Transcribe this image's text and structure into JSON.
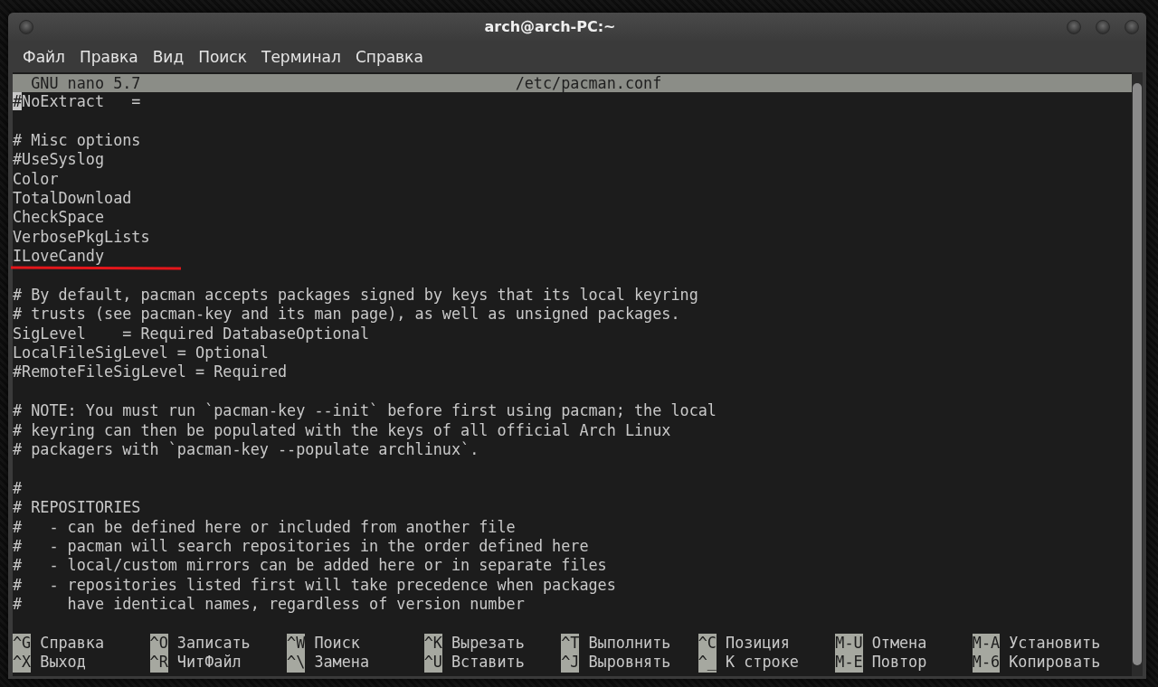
{
  "window": {
    "title": "arch@arch-PC:~"
  },
  "menu": [
    {
      "label": "Файл"
    },
    {
      "label": "Правка"
    },
    {
      "label": "Вид"
    },
    {
      "label": "Поиск"
    },
    {
      "label": "Терминал"
    },
    {
      "label": "Справка"
    }
  ],
  "nano_header": {
    "version": "GNU nano 5.7",
    "filename": "/etc/pacman.conf"
  },
  "lines": [
    {
      "kind": "text",
      "text": "#NoExtract   =",
      "cursor": true
    },
    {
      "kind": "blank"
    },
    {
      "kind": "text",
      "text": "# Misc options"
    },
    {
      "kind": "text",
      "text": "#UseSyslog"
    },
    {
      "kind": "text",
      "text": "Color"
    },
    {
      "kind": "text",
      "text": "TotalDownload"
    },
    {
      "kind": "text",
      "text": "CheckSpace"
    },
    {
      "kind": "text",
      "text": "VerbosePkgLists"
    },
    {
      "kind": "text",
      "text": "ILoveCandy",
      "underlined": true
    },
    {
      "kind": "blank"
    },
    {
      "kind": "text",
      "text": "# By default, pacman accepts packages signed by keys that its local keyring"
    },
    {
      "kind": "text",
      "text": "# trusts (see pacman-key and its man page), as well as unsigned packages."
    },
    {
      "kind": "text",
      "text": "SigLevel    = Required DatabaseOptional"
    },
    {
      "kind": "text",
      "text": "LocalFileSigLevel = Optional"
    },
    {
      "kind": "text",
      "text": "#RemoteFileSigLevel = Required"
    },
    {
      "kind": "blank"
    },
    {
      "kind": "text",
      "text": "# NOTE: You must run `pacman-key --init` before first using pacman; the local"
    },
    {
      "kind": "text",
      "text": "# keyring can then be populated with the keys of all official Arch Linux"
    },
    {
      "kind": "text",
      "text": "# packagers with `pacman-key --populate archlinux`."
    },
    {
      "kind": "blank"
    },
    {
      "kind": "text",
      "text": "#"
    },
    {
      "kind": "text",
      "text": "# REPOSITORIES"
    },
    {
      "kind": "text",
      "text": "#   - can be defined here or included from another file"
    },
    {
      "kind": "text",
      "text": "#   - pacman will search repositories in the order defined here"
    },
    {
      "kind": "text",
      "text": "#   - local/custom mirrors can be added here or in separate files"
    },
    {
      "kind": "text",
      "text": "#   - repositories listed first will take precedence when packages"
    },
    {
      "kind": "text",
      "text": "#     have identical names, regardless of version number"
    },
    {
      "kind": "blank"
    }
  ],
  "shortcuts": [
    [
      {
        "key": "^G",
        "label": "Справка"
      },
      {
        "key": "^O",
        "label": "Записать"
      },
      {
        "key": "^W",
        "label": "Поиск"
      },
      {
        "key": "^K",
        "label": "Вырезать"
      },
      {
        "key": "^T",
        "label": "Выполнить"
      },
      {
        "key": "^C",
        "label": "Позиция"
      },
      {
        "key": "M-U",
        "label": "Отмена"
      },
      {
        "key": "M-A",
        "label": "Установить"
      }
    ],
    [
      {
        "key": "^X",
        "label": "Выход"
      },
      {
        "key": "^R",
        "label": "ЧитФайл"
      },
      {
        "key": "^\\",
        "label": "Замена"
      },
      {
        "key": "^U",
        "label": "Вставить"
      },
      {
        "key": "^J",
        "label": "Выровнять"
      },
      {
        "key": "^_",
        "label": "К строке"
      },
      {
        "key": "M-E",
        "label": "Повтор"
      },
      {
        "key": "M-6",
        "label": "Копировать"
      }
    ]
  ]
}
